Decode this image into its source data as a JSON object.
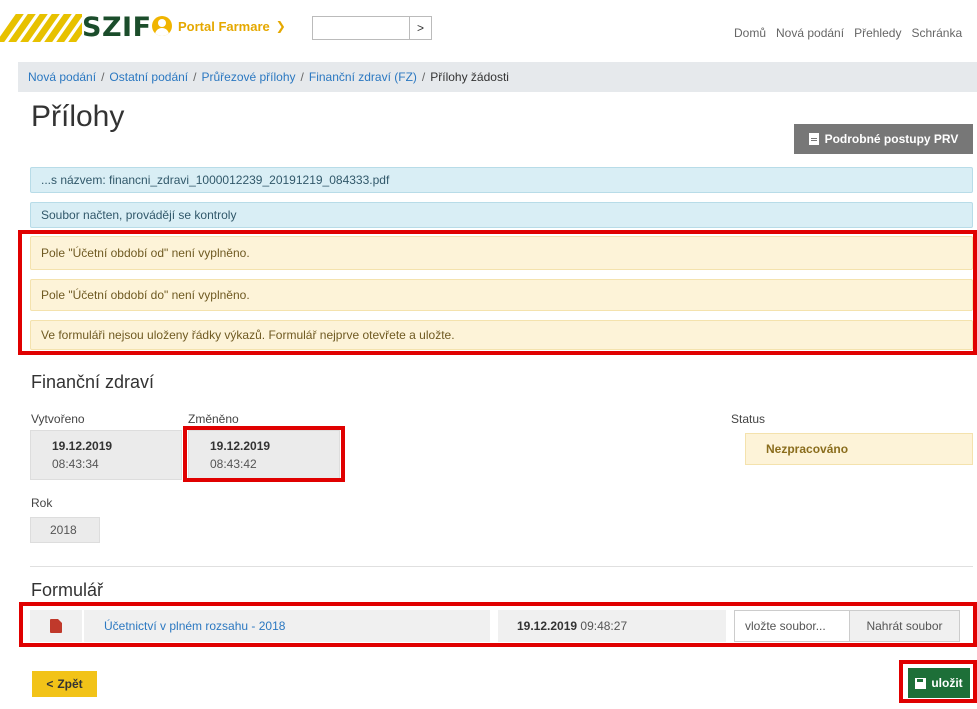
{
  "header": {
    "logo": "SZIF",
    "portal_label": "Portal Farmare",
    "search_value": "",
    "search_button": ">",
    "nav": [
      "Domů",
      "Nová podání",
      "Přehledy",
      "Schránka"
    ]
  },
  "breadcrumb": {
    "items": [
      "Nová podání",
      "Ostatní podání",
      "Průřezové přílohy",
      "Finanční zdraví (FZ)"
    ],
    "current": "Přílohy žádosti",
    "separator": "/"
  },
  "page_title": "Přílohy",
  "postupy_button": "Podrobné postupy PRV",
  "alerts": {
    "file": "...s názvem: financni_zdravi_1000012239_20191219_084333.pdf",
    "loaded": "Soubor načten, provádějí se kontroly",
    "warnings": [
      "Pole \"Účetní období od\" není vyplněno.",
      "Pole \"Účetní období do\" není vyplněno.",
      "Ve formuláři nejsou uloženy řádky výkazů. Formulář nejprve otevřete a uložte."
    ]
  },
  "financni_zdravi": {
    "title": "Finanční zdraví",
    "vytvoreno_label": "Vytvořeno",
    "vytvoreno_date": "19.12.2019",
    "vytvoreno_time": "08:43:34",
    "zmeneno_label": "Změněno",
    "zmeneno_date": "19.12.2019",
    "zmeneno_time": "08:43:42",
    "status_label": "Status",
    "status_value": "Nezpracováno",
    "rok_label": "Rok",
    "rok_value": "2018"
  },
  "formular": {
    "title": "Formulář",
    "link": "Účetnictví v plném rozsahu - 2018",
    "date": "19.12.2019",
    "time": "09:48:27",
    "file_placeholder": "vložte soubor...",
    "upload_button": "Nahrát soubor"
  },
  "buttons": {
    "back": "Zpět",
    "back_glyph": "<",
    "save": "uložit"
  },
  "colors": {
    "highlight": "#e00000",
    "accent_yellow": "#f2c318",
    "save_green": "#1d6f38",
    "link_blue": "#2b78c1"
  }
}
